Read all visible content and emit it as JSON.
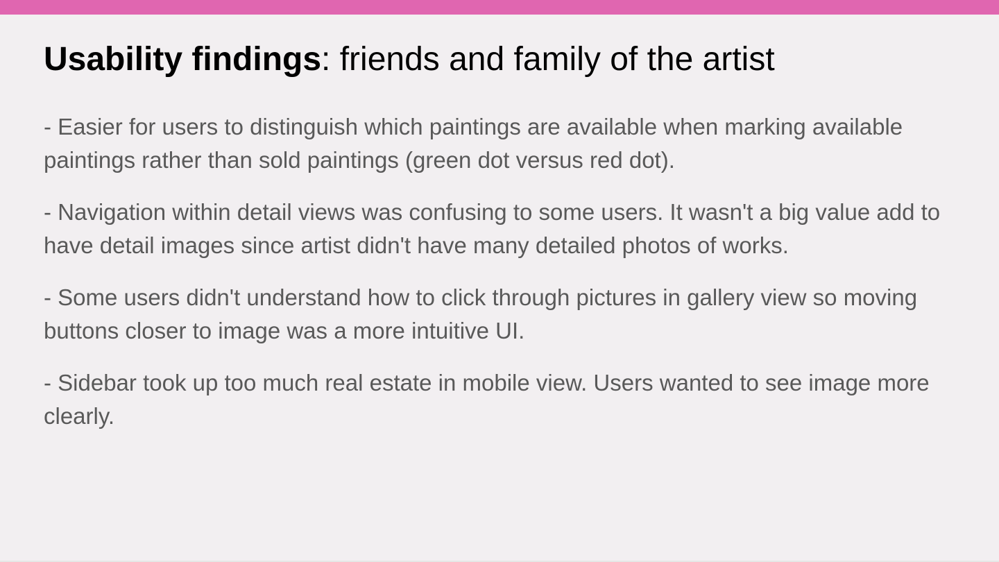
{
  "slide": {
    "accent_color": "#e066b0",
    "background_color": "#f2eff1",
    "title": {
      "bold": "Usability findings",
      "rest": ": friends and family of the artist"
    },
    "bullets": [
      "- Easier for users to distinguish which paintings are available when marking available paintings rather than sold paintings (green dot versus red dot).",
      "- Navigation within detail views was confusing to some users. It wasn't a big value add to have detail images since artist didn't have many detailed photos of works.",
      "- Some users didn't understand how to click through pictures in gallery view so moving buttons closer to image was a more intuitive UI.",
      "- Sidebar took up too much real estate in mobile view. Users wanted to see image more clearly."
    ]
  }
}
